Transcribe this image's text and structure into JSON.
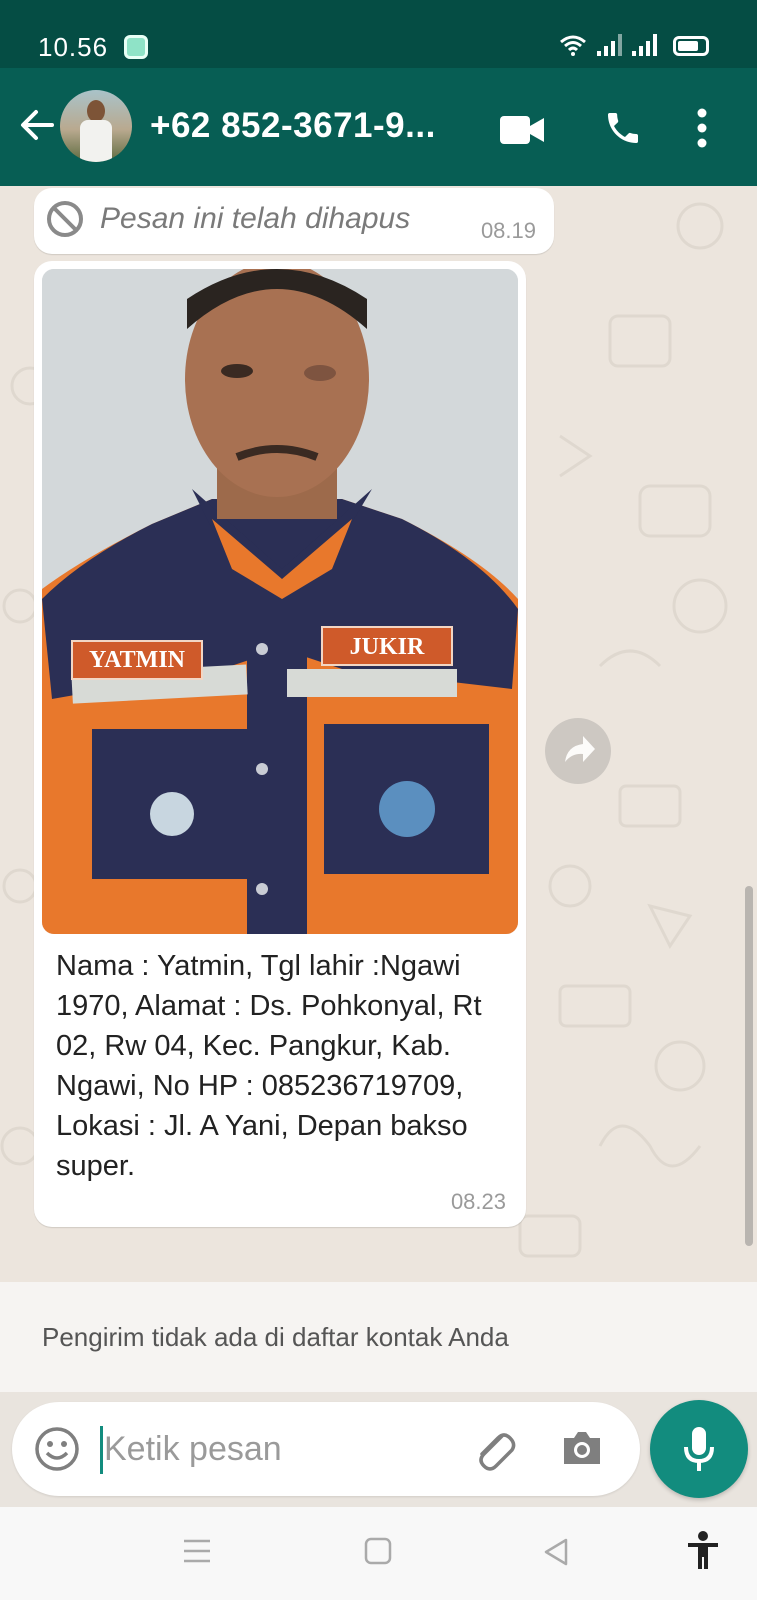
{
  "status_bar": {
    "time": "10.56"
  },
  "header": {
    "contact_name": "+62 852-3671-9...",
    "back_label": "←"
  },
  "messages": [
    {
      "type": "deleted",
      "text": "Pesan ini telah dihapus",
      "time": "08.19"
    },
    {
      "type": "image",
      "photo_labels": {
        "name_patch": "YATMIN",
        "role_patch": "JUKIR"
      },
      "caption": "Nama : Yatmin, Tgl lahir :Ngawi 1970, Alamat : Ds. Pohkonyal, Rt 02, Rw 04, Kec. Pangkur, Kab. Ngawi, No HP : 085236719709, Lokasi : Jl. A Yani, Depan bakso super.",
      "time": "08.23"
    }
  ],
  "notice": {
    "text": "Pengirim tidak ada di daftar kontak Anda"
  },
  "composer": {
    "placeholder": "Ketik pesan"
  },
  "icons": {
    "back": "back-arrow-icon",
    "video": "video-call-icon",
    "call": "phone-icon",
    "menu": "more-vert-icon",
    "deleted": "blocked-icon",
    "forward": "forward-icon",
    "emoji": "emoji-icon",
    "attach": "paperclip-icon",
    "camera": "camera-icon",
    "mic": "microphone-icon",
    "nav_menu": "recents-icon",
    "nav_home": "home-icon",
    "nav_back": "nav-back-icon",
    "accessibility": "accessibility-icon"
  },
  "colors": {
    "header": "#075e54",
    "status_bar": "#054d44",
    "accent": "#128c7e",
    "chat_bg": "#ece5dd"
  }
}
